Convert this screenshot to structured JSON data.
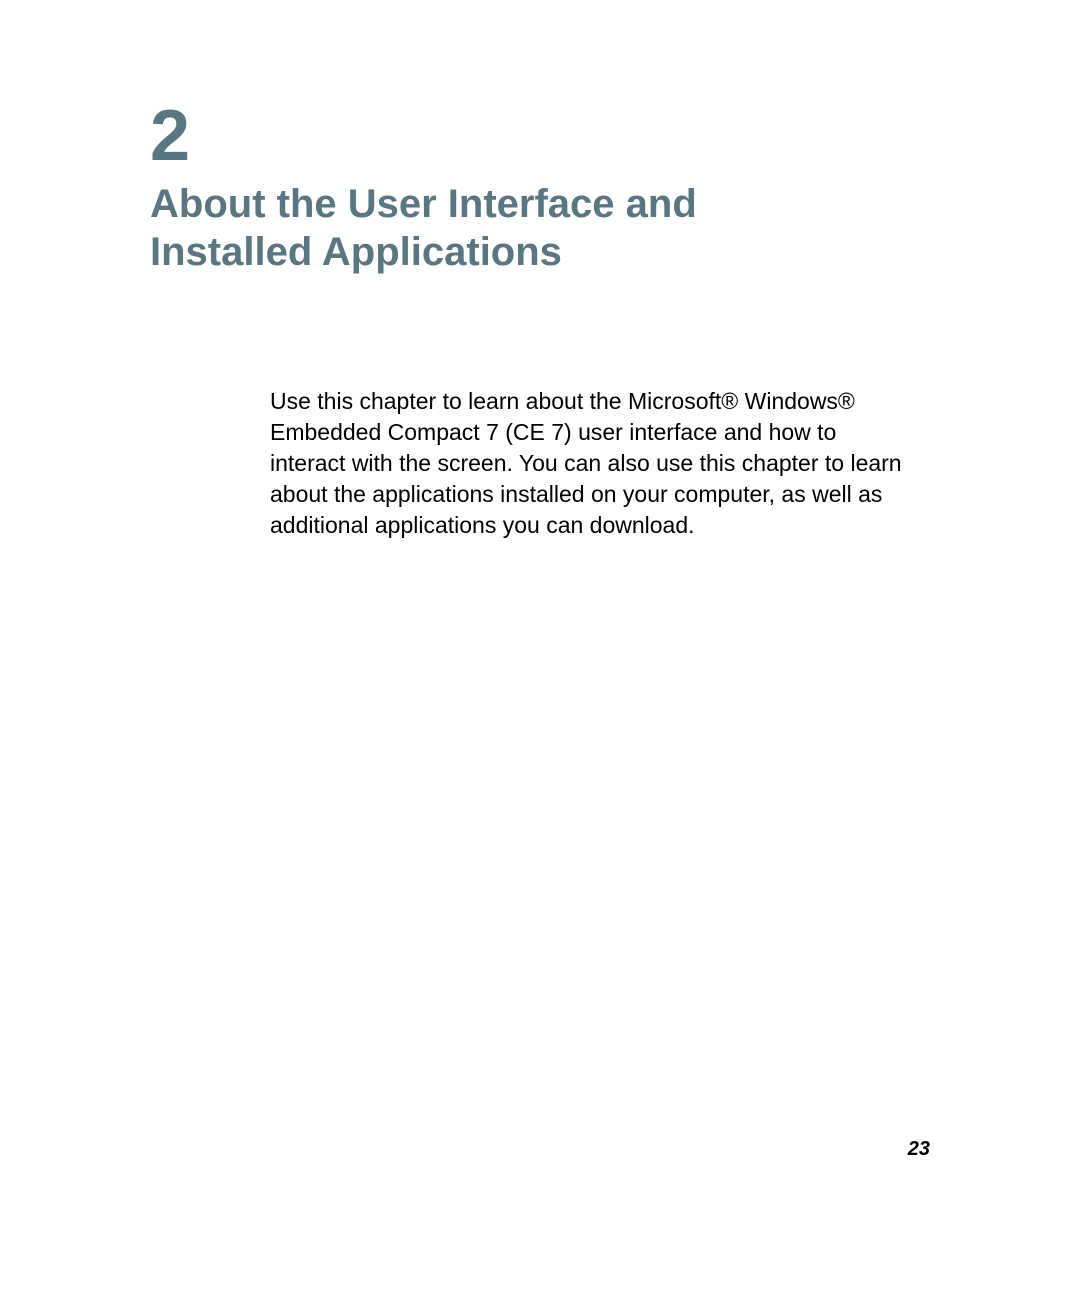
{
  "chapter": {
    "number": "2",
    "title": "About the User Interface and Installed Applications"
  },
  "body": {
    "paragraph": "Use this chapter to learn about the Microsoft® Windows® Embedded Compact 7 (CE 7) user interface and how to interact with the screen. You can also use this chapter to learn about the applications installed on your computer, as well as additional applications you can download."
  },
  "footer": {
    "page_number": "23"
  }
}
